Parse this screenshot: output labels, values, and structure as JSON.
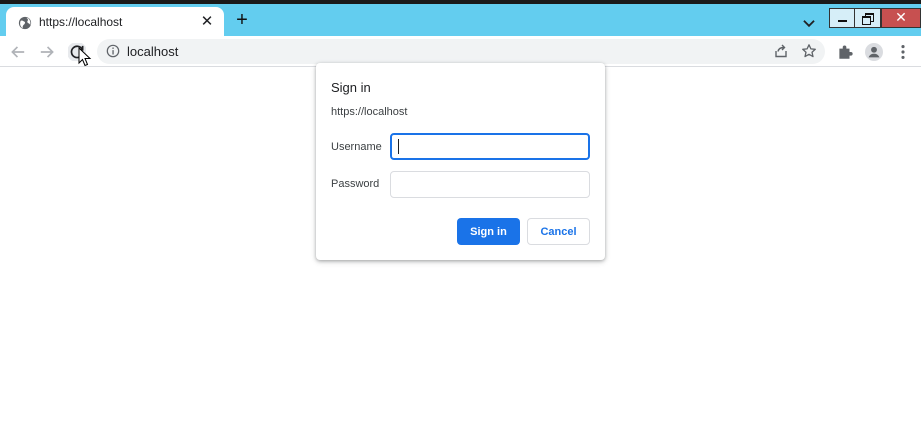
{
  "browser": {
    "tab": {
      "title": "https://localhost",
      "favicon": "globe-icon",
      "close_icon": "close-icon"
    },
    "new_tab_icon": "plus-icon",
    "tab_search_icon": "chevron-down-icon",
    "window_controls": {
      "minimize": "minimize-icon",
      "restore": "restore-icon",
      "close": "close-icon"
    },
    "toolbar": {
      "back_icon": "arrow-left-icon",
      "forward_icon": "arrow-right-icon",
      "reload_icon": "reload-icon",
      "site_info_icon": "info-icon",
      "url": "localhost",
      "share_icon": "share-icon",
      "bookmark_icon": "star-icon",
      "extensions_icon": "puzzle-icon",
      "profile_icon": "person-icon",
      "menu_icon": "kebab-menu-icon"
    },
    "colors": {
      "titlebar": "#63cdef",
      "accent": "#1a73e8",
      "close": "#c75050"
    }
  },
  "dialog": {
    "title": "Sign in",
    "origin": "https://localhost",
    "username_label": "Username",
    "username_value": "",
    "password_label": "Password",
    "password_value": "",
    "sign_in_label": "Sign in",
    "cancel_label": "Cancel"
  }
}
